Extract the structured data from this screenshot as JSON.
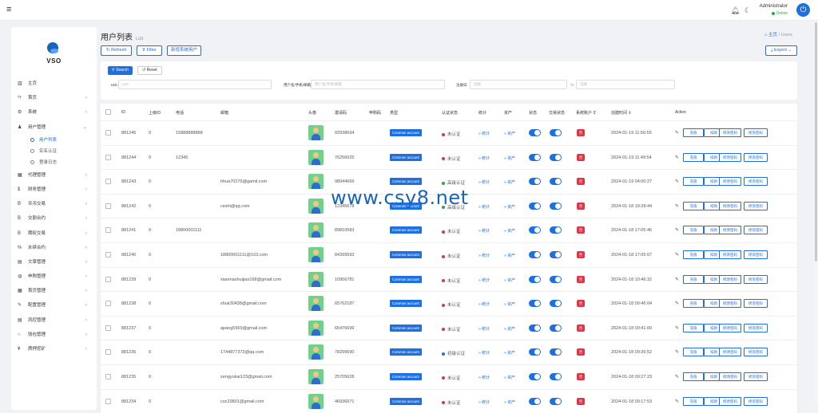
{
  "topbar": {
    "user_name": "Administrator",
    "user_status": "Online"
  },
  "sidebar": {
    "logo": "VSO",
    "items": [
      {
        "icon": "▥",
        "label": "主页",
        "chevron": false
      },
      {
        "icon": "ᴬᵞ",
        "label": "首页",
        "chevron": true
      },
      {
        "icon": "⚙",
        "label": "系统",
        "chevron": true
      },
      {
        "icon": "♟",
        "label": "用户管理",
        "chevron": true,
        "open": true
      },
      {
        "icon": "▦",
        "label": "代理管理",
        "chevron": true
      },
      {
        "icon": "$",
        "label": "财务管理",
        "chevron": true
      },
      {
        "icon": "B",
        "label": "币币交易",
        "chevron": true
      },
      {
        "icon": "B",
        "label": "交割合约",
        "chevron": true
      },
      {
        "icon": "B",
        "label": "期权交易",
        "chevron": true
      },
      {
        "icon": "%",
        "label": "永续合约",
        "chevron": true
      },
      {
        "icon": "▤",
        "label": "文章管理",
        "chevron": true
      },
      {
        "icon": "◍",
        "label": "申购管理",
        "chevron": true
      },
      {
        "icon": "▦",
        "label": "首页管理",
        "chevron": true
      },
      {
        "icon": "✎",
        "label": "配置管理",
        "chevron": true
      },
      {
        "icon": "▤",
        "label": "风控管理",
        "chevron": true
      },
      {
        "icon": "○",
        "label": "钱包管理",
        "chevron": true
      },
      {
        "icon": "¥",
        "label": "质押挖矿",
        "chevron": true
      }
    ],
    "subitems": [
      {
        "label": "用户列表",
        "active": true
      },
      {
        "label": "实名认证",
        "active": false
      },
      {
        "label": "登录日志",
        "active": false
      }
    ]
  },
  "page": {
    "title": "用户列表",
    "subtitle": "List",
    "crumb_home": "主页",
    "crumb_sep": "/",
    "crumb_current": "Users"
  },
  "toolbar": {
    "refresh": "Refresh",
    "filter": "Filter",
    "add": "新增系统用户",
    "export": "Export"
  },
  "search": {
    "search_btn": "Search",
    "reset_btn": "Reset",
    "uid_label": "UID",
    "uid_placeholder": "UID",
    "account_label": "用户名/手机/邮箱",
    "account_placeholder": "用户名/手机/邮箱",
    "time_label": "注册日",
    "time_from": "选择",
    "time_sep": "To",
    "time_to": "选择"
  },
  "table": {
    "headers": {
      "id": "ID",
      "parent": "上级ID",
      "phone": "电话",
      "email": "邮箱",
      "avatar": "头像",
      "invite": "邀请码",
      "apply": "申购码",
      "type": "类型",
      "auth": "认证状态",
      "stats": "统计",
      "assets": "资产",
      "status": "状态",
      "trade": "交易状态",
      "sys": "系统账户",
      "created": "创建时间",
      "action": "Action"
    },
    "link_stats": "统计",
    "link_assets": "资产",
    "sys_no": "否",
    "action_btns": [
      "充值",
      "扣款",
      "修改密码",
      "修资密码"
    ],
    "rows": [
      {
        "id": "881245",
        "parent": "0",
        "phone": "15888888888",
        "email": "",
        "invite": "02938694",
        "type": "Common account",
        "auth": "未认证",
        "auth_color": "#dc3545",
        "created": "2024-01-19 11:56:59"
      },
      {
        "id": "881244",
        "parent": "0",
        "phone": "12345",
        "email": "",
        "invite": "76256025",
        "type": "Common account",
        "auth": "未认证",
        "auth_color": "#dc3545",
        "created": "2024-01-19 11:49:54"
      },
      {
        "id": "881243",
        "parent": "0",
        "phone": "",
        "email": "hhua70276@gamil.com",
        "invite": "98944669",
        "type": "Common account",
        "auth": "高级认证",
        "auth_color": "#28a745",
        "created": "2024-01-19 04:00:27"
      },
      {
        "id": "881242",
        "parent": "0",
        "phone": "",
        "email": "ceshi@qq.com",
        "invite": "12345678",
        "type": "Common account",
        "auth": "高级认证",
        "auth_color": "#28a745",
        "created": "2024-01-18 19:28:44"
      },
      {
        "id": "881241",
        "parent": "0",
        "phone": "18800001111",
        "email": "",
        "invite": "89810583",
        "type": "Common account",
        "auth": "未认证",
        "auth_color": "#dc3545",
        "created": "2024-01-18 17:05:46"
      },
      {
        "id": "881240",
        "parent": "0",
        "phone": "",
        "email": "18800001111@163.com",
        "invite": "84399593",
        "type": "Common account",
        "auth": "未认证",
        "auth_color": "#dc3545",
        "created": "2024-01-18 17:05:07"
      },
      {
        "id": "881239",
        "parent": "0",
        "phone": "",
        "email": "xiaomashuijiao168@gmail.com",
        "invite": "10956781",
        "type": "Common account",
        "auth": "未认证",
        "auth_color": "#dc3545",
        "created": "2024-01-18 10:46:32"
      },
      {
        "id": "881238",
        "parent": "0",
        "phone": "",
        "email": "shuk30438@gmail.com",
        "invite": "65762187",
        "type": "Common account",
        "auth": "未认证",
        "auth_color": "#dc3545",
        "created": "2024-01-18 09:46:04"
      },
      {
        "id": "881237",
        "parent": "0",
        "phone": "",
        "email": "apang5569@gmail.com",
        "invite": "65476699",
        "type": "Common account",
        "auth": "未认证",
        "auth_color": "#dc3545",
        "created": "2024-01-18 09:41:09"
      },
      {
        "id": "881236",
        "parent": "0",
        "phone": "",
        "email": "1744877373@qq.com",
        "invite": "78299690",
        "type": "Common account",
        "auth": "初级认证",
        "auth_color": "#1e6fe0",
        "created": "2024-01-18 09:35:52"
      },
      {
        "id": "881235",
        "parent": "0",
        "phone": "",
        "email": "zengyukai123@gmail.com",
        "invite": "25705628",
        "type": "Common account",
        "auth": "未认证",
        "auth_color": "#dc3545",
        "created": "2024-01-18 09:27:23"
      },
      {
        "id": "881234",
        "parent": "0",
        "phone": "",
        "email": "coc29801@gmail.com",
        "invite": "46936671",
        "type": "Common account",
        "auth": "未认证",
        "auth_color": "#dc3545",
        "created": "2024-01-18 09:17:53"
      }
    ]
  },
  "watermark": "www.csy8.net"
}
